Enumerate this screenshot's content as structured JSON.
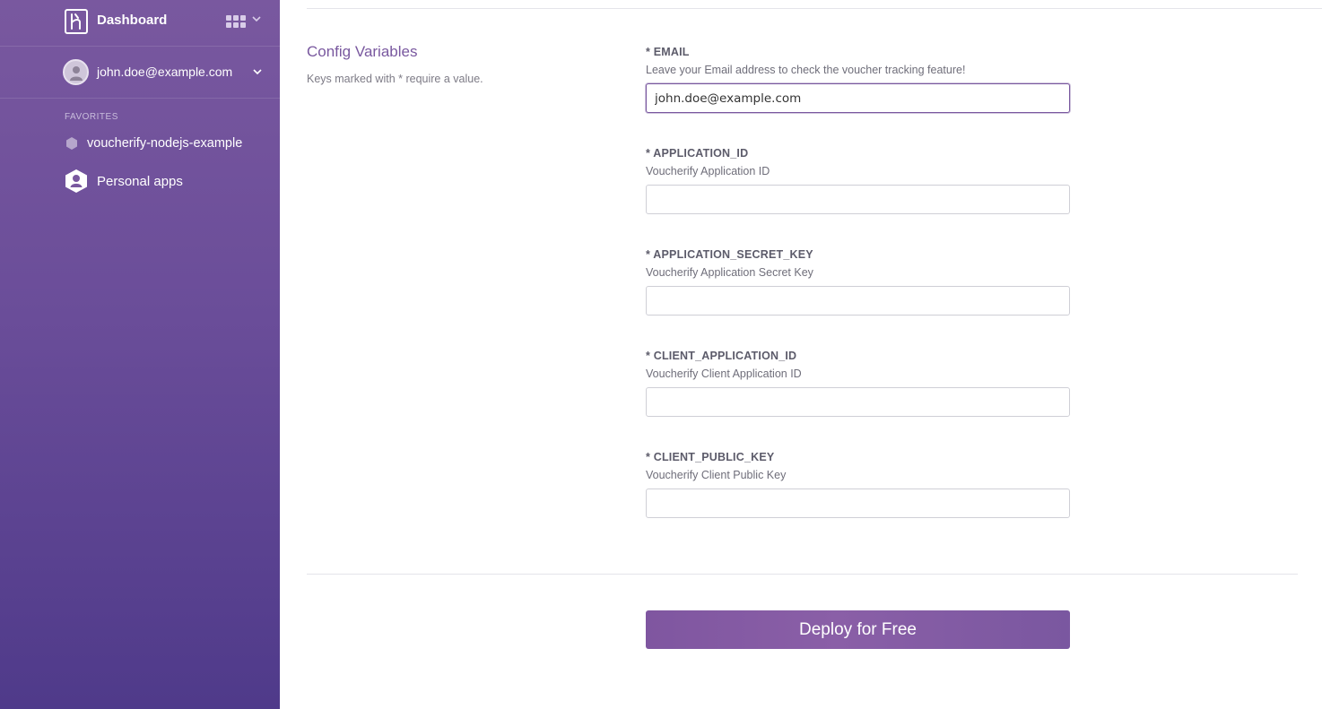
{
  "sidebar": {
    "title": "Dashboard",
    "account_email": "john.doe@example.com",
    "favorites_heading": "FAVORITES",
    "favorite_app": "voucherify-nodejs-example",
    "personal_apps": "Personal apps"
  },
  "main": {
    "section_title": "Config Variables",
    "section_help": "Keys marked with * require a value.",
    "fields": [
      {
        "label": "* EMAIL",
        "description": "Leave your Email address to check the voucher tracking feature!",
        "value": "john.doe@example.com"
      },
      {
        "label": "* APPLICATION_ID",
        "description": "Voucherify Application ID",
        "value": ""
      },
      {
        "label": "* APPLICATION_SECRET_KEY",
        "description": "Voucherify Application Secret Key",
        "value": ""
      },
      {
        "label": "* CLIENT_APPLICATION_ID",
        "description": "Voucherify Client Application ID",
        "value": ""
      },
      {
        "label": "* CLIENT_PUBLIC_KEY",
        "description": "Voucherify Client Public Key",
        "value": ""
      }
    ],
    "deploy_label": "Deploy for Free"
  },
  "colors": {
    "brand": "#79589f",
    "sidebar_bottom": "#4f3a8a",
    "button": "#8a5fa7"
  },
  "icons": {
    "logo": "heroku-logo-icon",
    "apps": "apps-grid-icon",
    "favorite": "hexagon-app-icon",
    "personal": "person-hexagon-icon"
  }
}
